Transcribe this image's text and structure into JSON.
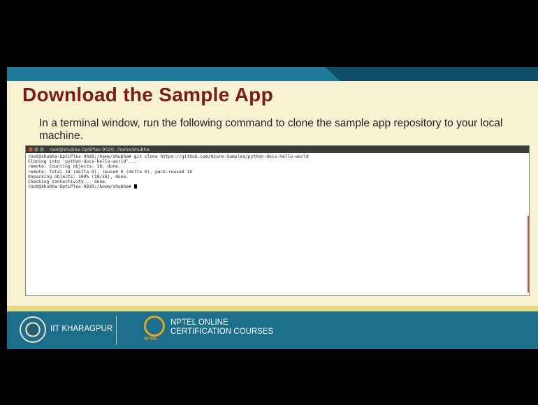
{
  "slide": {
    "title": "Download the Sample App",
    "subtitle": "In a terminal window, run the following command to clone the sample app repository to your local machine."
  },
  "terminal": {
    "window_title": "root@shubha-OptiPlex-9020: /home/shubha",
    "lines": [
      "root@shubha-OptiPlex-9020:/home/shubha# git clone https://github.com/Azure-Samples/python-docs-hello-world",
      "Cloning into 'python-docs-hello-world'...",
      "remote: Counting objects: 18, done.",
      "remote: Total 18 (delta 0), reused 0 (delta 0), pack-reused 18",
      "Unpacking objects: 100% (18/18), done.",
      "Checking connectivity... done.",
      "root@shubha-OptiPlex-9020:/home/shubha# "
    ]
  },
  "footer": {
    "iit_label": "IIT KHARAGPUR",
    "nptel_line1": "NPTEL ONLINE",
    "nptel_line2": "CERTIFICATION COURSES",
    "nptel_small": "NPTEL"
  }
}
